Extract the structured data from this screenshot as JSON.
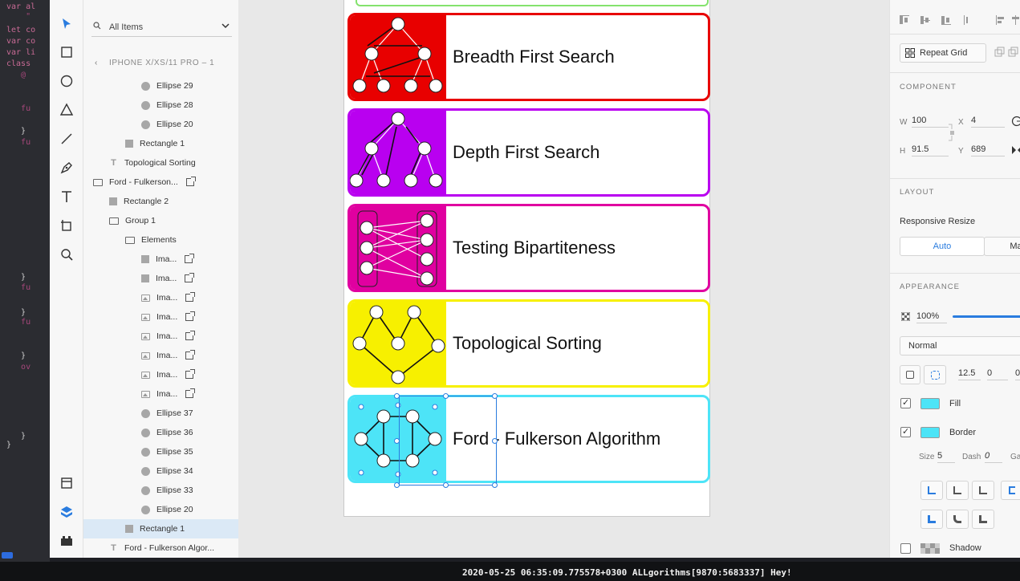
{
  "editor_lines": [
    {
      "text": "var al",
      "cls": ""
    },
    {
      "text": "    \"",
      "cls": "dim"
    },
    {
      "text": "let co",
      "cls": ""
    },
    {
      "text": "var co",
      "cls": ""
    },
    {
      "text": "var li",
      "cls": ""
    },
    {
      "text": "class",
      "cls": ""
    },
    {
      "text": "   @",
      "cls": "dim"
    },
    {
      "text": "   fu",
      "cls": "dim"
    },
    {
      "text": "   }",
      "cls": "w"
    },
    {
      "text": "   fu",
      "cls": "dim"
    },
    {
      "text": "   }",
      "cls": "w"
    },
    {
      "text": "   fu",
      "cls": "dim"
    },
    {
      "text": "   }",
      "cls": "w"
    },
    {
      "text": "   fu",
      "cls": "dim"
    },
    {
      "text": "   }",
      "cls": "w"
    },
    {
      "text": "   ov",
      "cls": "dim"
    },
    {
      "text": "   }",
      "cls": "w"
    },
    {
      "text": "}",
      "cls": "w"
    }
  ],
  "console": {
    "text": "2020-05-25 06:35:09.775578+0300 ALLgorithms[9870:5683337] Hey!"
  },
  "toolbar": {
    "tools": [
      "select-tool",
      "rectangle-tool",
      "ellipse-tool",
      "polygon-tool",
      "line-tool",
      "pen-tool",
      "text-tool",
      "artboard-tool",
      "zoom-tool"
    ],
    "bottom": [
      "assets-panel",
      "layers-panel",
      "plugins-panel"
    ]
  },
  "layers": {
    "search_label": "All Items",
    "breadcrumb": "IPHONE X/XS/11 PRO – 1",
    "items": [
      {
        "label": "Ellipse 29",
        "icon": "ellipse",
        "indent": 3
      },
      {
        "label": "Ellipse 28",
        "icon": "ellipse",
        "indent": 3
      },
      {
        "label": "Ellipse 20",
        "icon": "ellipse",
        "indent": 3
      },
      {
        "label": "Rectangle 1",
        "icon": "rect",
        "indent": 2
      },
      {
        "label": "Topological Sorting",
        "icon": "text",
        "indent": 1
      },
      {
        "label": "Ford - Fulkerson...",
        "icon": "folder",
        "indent": 0,
        "link": true
      },
      {
        "label": "Rectangle 2",
        "icon": "rect",
        "indent": 1
      },
      {
        "label": "Group 1",
        "icon": "folder",
        "indent": 1
      },
      {
        "label": "Elements",
        "icon": "folder",
        "indent": 2
      },
      {
        "label": "Ima...",
        "icon": "rect",
        "indent": 3,
        "link": true
      },
      {
        "label": "Ima...",
        "icon": "rect",
        "indent": 3,
        "link": true
      },
      {
        "label": "Ima...",
        "icon": "img",
        "indent": 3,
        "link": true
      },
      {
        "label": "Ima...",
        "icon": "img",
        "indent": 3,
        "link": true
      },
      {
        "label": "Ima...",
        "icon": "img",
        "indent": 3,
        "link": true
      },
      {
        "label": "Ima...",
        "icon": "img",
        "indent": 3,
        "link": true
      },
      {
        "label": "Ima...",
        "icon": "img",
        "indent": 3,
        "link": true
      },
      {
        "label": "Ima...",
        "icon": "img",
        "indent": 3,
        "link": true
      },
      {
        "label": "Ellipse 37",
        "icon": "ellipse",
        "indent": 3
      },
      {
        "label": "Ellipse 36",
        "icon": "ellipse",
        "indent": 3
      },
      {
        "label": "Ellipse 35",
        "icon": "ellipse",
        "indent": 3
      },
      {
        "label": "Ellipse 34",
        "icon": "ellipse",
        "indent": 3
      },
      {
        "label": "Ellipse 33",
        "icon": "ellipse",
        "indent": 3
      },
      {
        "label": "Ellipse 20",
        "icon": "ellipse",
        "indent": 3
      },
      {
        "label": "Rectangle 1",
        "icon": "rect",
        "indent": 2,
        "selected": true
      },
      {
        "label": "Ford - Fulkerson Algor...",
        "icon": "text",
        "indent": 1
      }
    ]
  },
  "cards": [
    {
      "title": "Breadth First Search",
      "color": "#e80000",
      "border": "#e80000",
      "graph": "tree-bfs"
    },
    {
      "title": "Depth First Search",
      "color": "#b900f0",
      "border": "#b900f0",
      "graph": "tree-dfs"
    },
    {
      "title": "Testing Bipartiteness",
      "color": "#e000a0",
      "border": "#e000a0",
      "graph": "bipartite"
    },
    {
      "title": "Topological Sorting",
      "color": "#f7f000",
      "border": "#f7f000",
      "graph": "topo"
    },
    {
      "title": "Ford - Fulkerson Algorithm",
      "color": "#4de4f7",
      "border": "#4de4f7",
      "graph": "flow"
    }
  ],
  "props": {
    "repeat_grid": "Repeat Grid",
    "component_title": "COMPONENT",
    "w_label": "W",
    "w": "100",
    "x_label": "X",
    "x": "4",
    "h_label": "H",
    "h": "91.5",
    "y_label": "Y",
    "y": "689",
    "layout_title": "LAYOUT",
    "responsive_resize": "Responsive Resize",
    "auto": "Auto",
    "manual": "Ma",
    "appearance_title": "APPEARANCE",
    "opacity": "100%",
    "blend_mode": "Normal",
    "radius": "12.5",
    "radius2": "0",
    "radius3": "0",
    "fill_label": "Fill",
    "fill_color": "#4de4f7",
    "border_label": "Border",
    "border_color": "#4de4f7",
    "size_label": "Size",
    "size": "5",
    "dash_label": "Dash",
    "dash": "0",
    "gap_label": "Gap",
    "shadow_label": "Shadow"
  }
}
